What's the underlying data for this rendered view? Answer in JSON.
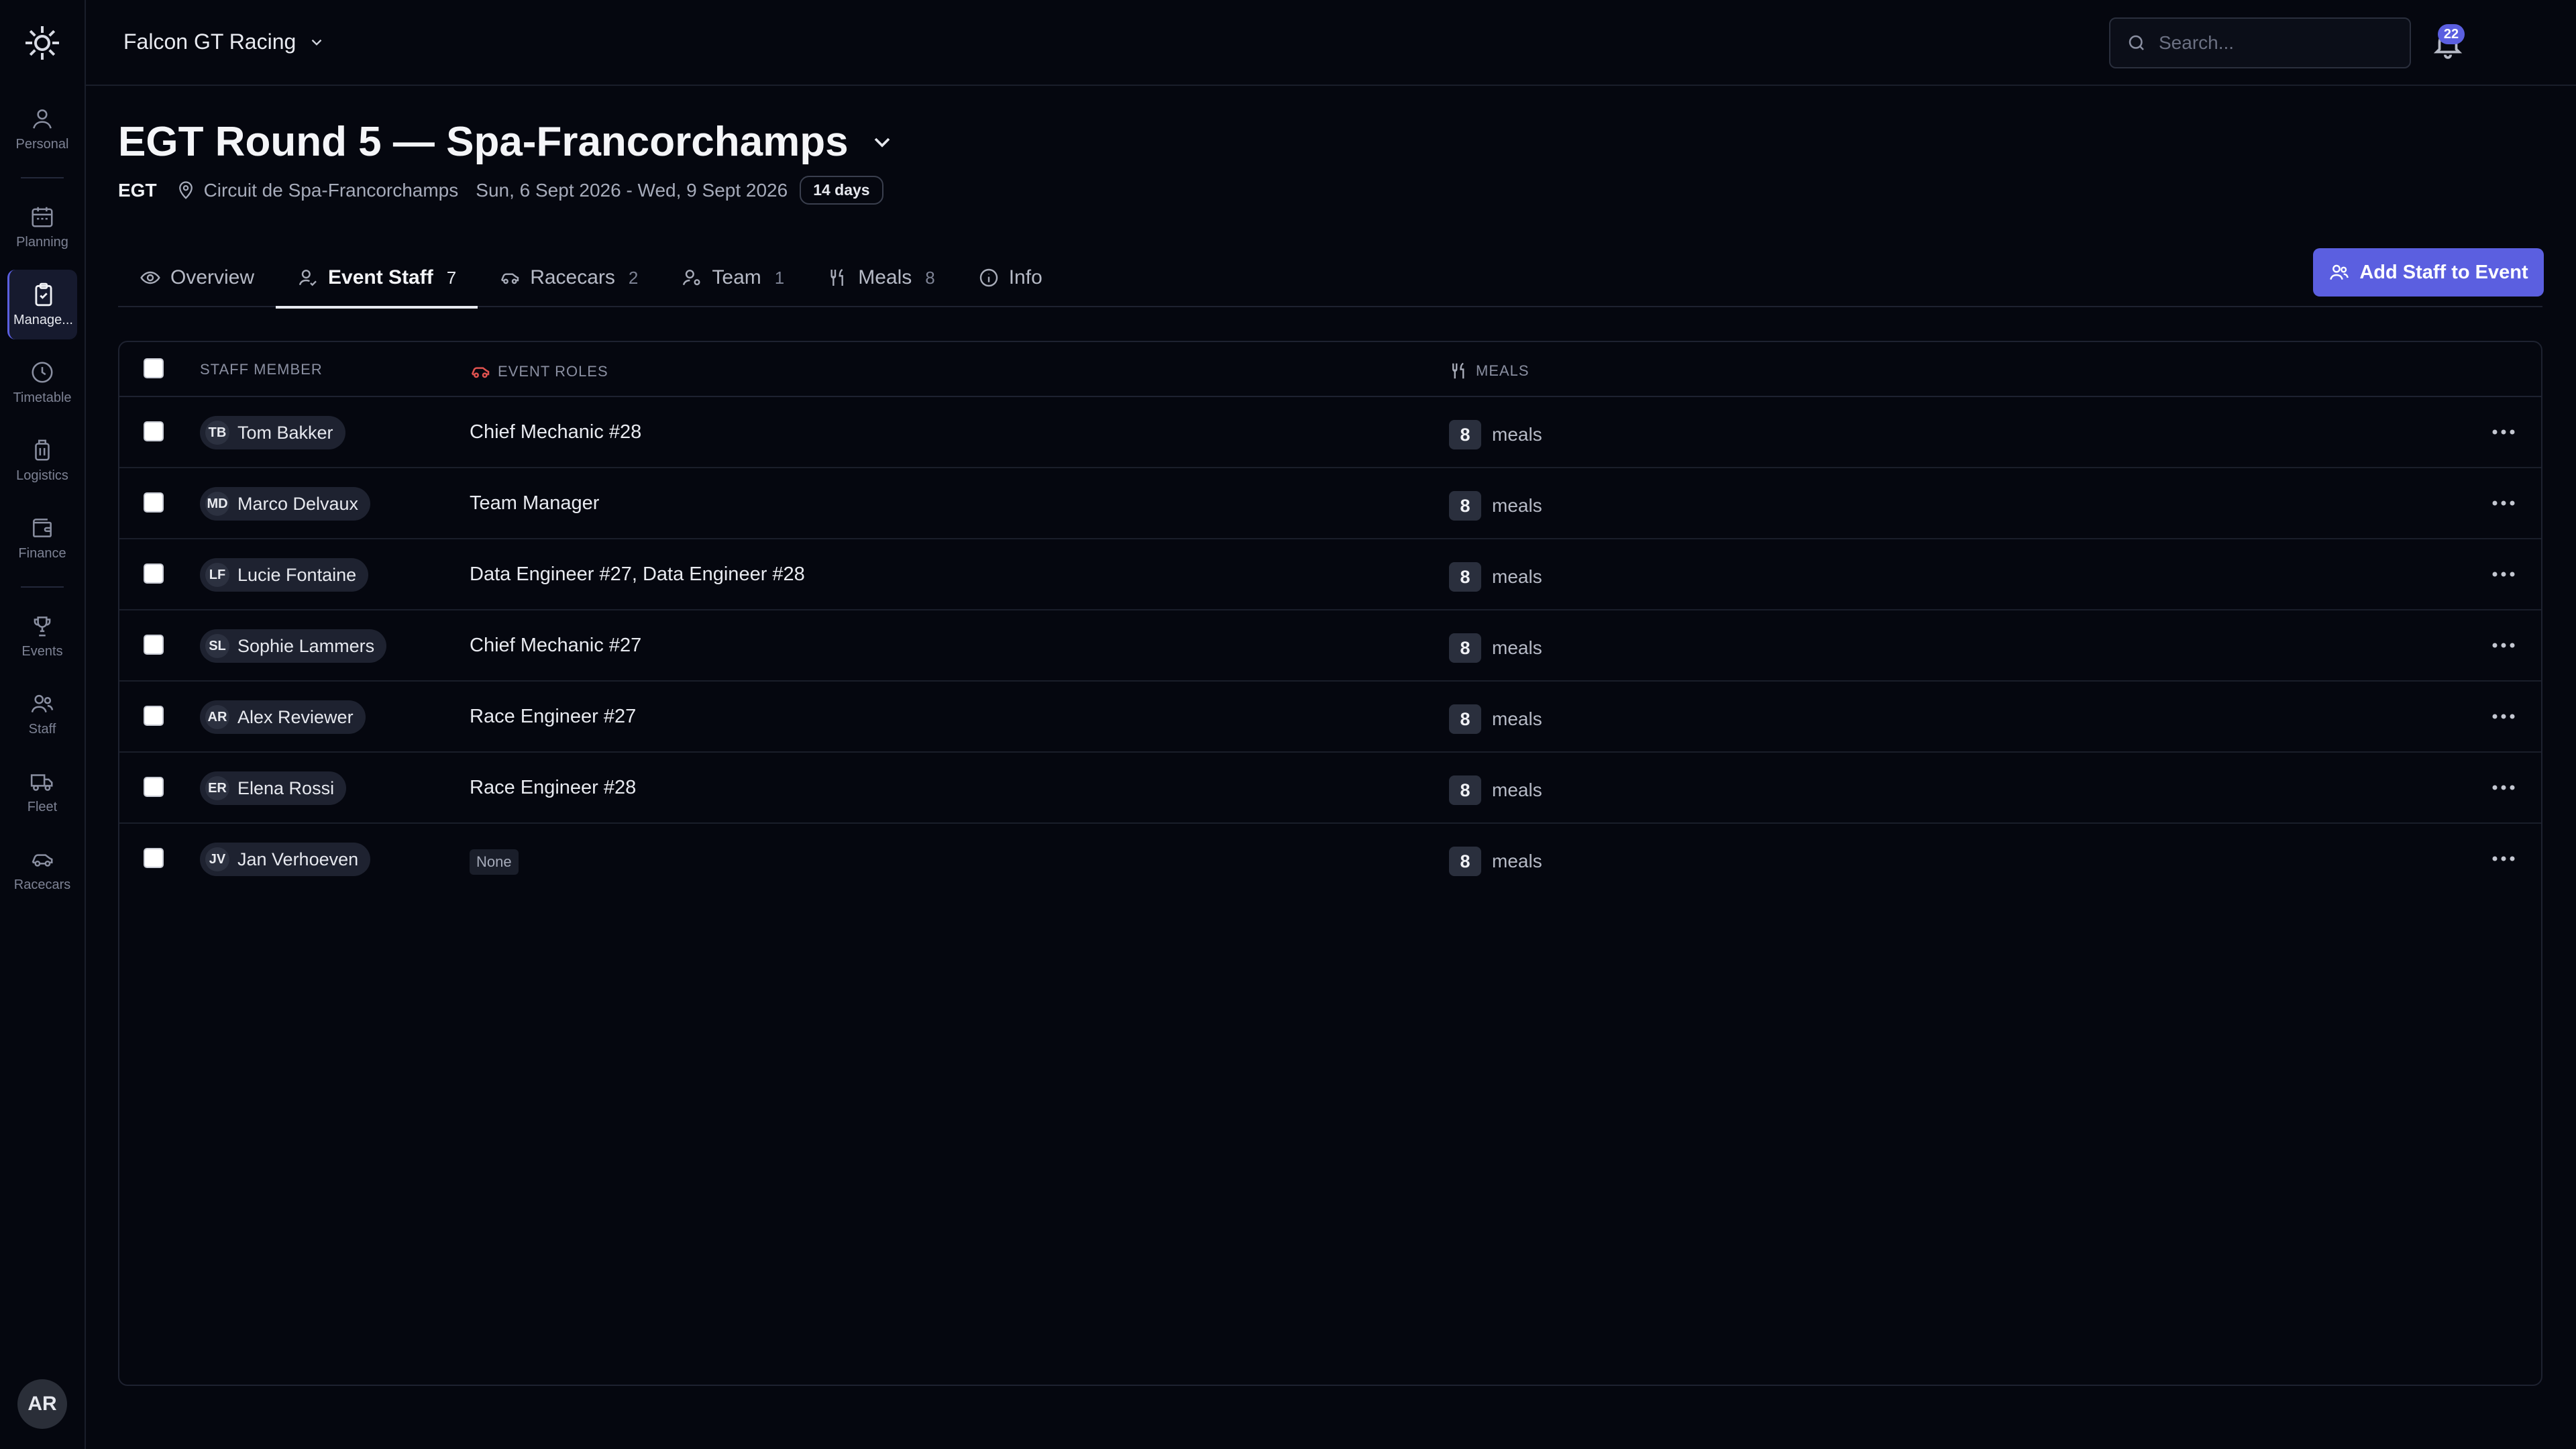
{
  "topbar": {
    "org_name": "Falcon GT Racing",
    "search_placeholder": "Search...",
    "notification_count": "22"
  },
  "sidebar": {
    "items": [
      {
        "label": "Personal",
        "icon": "user-icon"
      },
      {
        "label": "Planning",
        "icon": "calendar-icon"
      },
      {
        "label": "Manage...",
        "icon": "clipboard-check-icon"
      },
      {
        "label": "Timetable",
        "icon": "clock-icon"
      },
      {
        "label": "Logistics",
        "icon": "luggage-icon"
      },
      {
        "label": "Finance",
        "icon": "wallet-icon"
      },
      {
        "label": "Events",
        "icon": "trophy-icon"
      },
      {
        "label": "Staff",
        "icon": "users-icon"
      },
      {
        "label": "Fleet",
        "icon": "truck-icon"
      },
      {
        "label": "Racecars",
        "icon": "car-icon"
      }
    ],
    "user_initials": "AR"
  },
  "event": {
    "title": "EGT Round 5 — Spa-Francorchamps",
    "series": "EGT",
    "location": "Circuit de Spa-Francorchamps",
    "dates": "Sun, 6 Sept 2026 - Wed, 9 Sept 2026",
    "duration": "14 days"
  },
  "tabs": [
    {
      "label": "Overview",
      "count": ""
    },
    {
      "label": "Event Staff",
      "count": "7"
    },
    {
      "label": "Racecars",
      "count": "2"
    },
    {
      "label": "Team",
      "count": "1"
    },
    {
      "label": "Meals",
      "count": "8"
    },
    {
      "label": "Info",
      "count": ""
    }
  ],
  "add_button": "Add Staff to Event",
  "table": {
    "headers": {
      "staff": "STAFF MEMBER",
      "roles": "EVENT ROLES",
      "meals": "MEALS"
    },
    "rows": [
      {
        "initials": "TB",
        "name": "Tom Bakker",
        "roles": "Chief Mechanic #28",
        "meals": "8"
      },
      {
        "initials": "MD",
        "name": "Marco Delvaux",
        "roles": "Team Manager",
        "meals": "8"
      },
      {
        "initials": "LF",
        "name": "Lucie Fontaine",
        "roles": "Data Engineer #27, Data Engineer #28",
        "meals": "8"
      },
      {
        "initials": "SL",
        "name": "Sophie Lammers",
        "roles": "Chief Mechanic #27",
        "meals": "8"
      },
      {
        "initials": "AR",
        "name": "Alex Reviewer",
        "roles": "Race Engineer #27",
        "meals": "8"
      },
      {
        "initials": "ER",
        "name": "Elena Rossi",
        "roles": "Race Engineer #28",
        "meals": "8"
      },
      {
        "initials": "JV",
        "name": "Jan Verhoeven",
        "roles": "None",
        "meals": "8"
      }
    ],
    "meals_unit": "meals"
  },
  "colors": {
    "accent": "#5b5fe0",
    "background": "#05070f",
    "role_icon": "#e0524f"
  }
}
